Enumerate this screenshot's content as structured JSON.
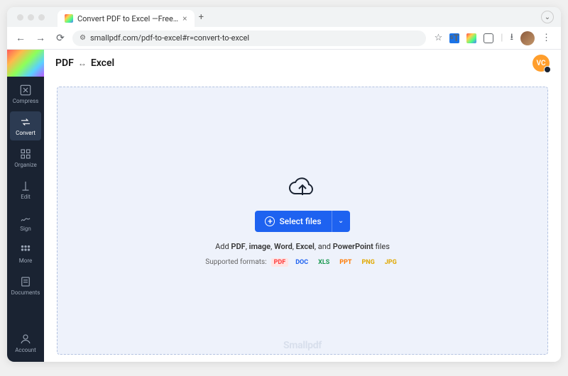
{
  "browser": {
    "tab_title": "Convert PDF to Excel —Free…",
    "url": "smallpdf.com/pdf-to-excel#r=convert-to-excel"
  },
  "sidebar": {
    "items": [
      {
        "label": "Compress"
      },
      {
        "label": "Convert"
      },
      {
        "label": "Organize"
      },
      {
        "label": "Edit"
      },
      {
        "label": "Sign"
      },
      {
        "label": "More"
      },
      {
        "label": "Documents"
      }
    ],
    "account_label": "Account"
  },
  "page": {
    "title_left": "PDF",
    "title_right": "Excel",
    "avatar_initials": "VC"
  },
  "upload": {
    "button_label": "Select files",
    "hint_prefix": "Add ",
    "hint_b1": "PDF",
    "hint_s1": ", ",
    "hint_b2": "image",
    "hint_s2": ", ",
    "hint_b3": "Word",
    "hint_s3": ", ",
    "hint_b4": "Excel",
    "hint_s4": ", and ",
    "hint_b5": "PowerPoint",
    "hint_suffix": " files",
    "supported_label": "Supported formats:",
    "formats": {
      "pdf": "PDF",
      "doc": "DOC",
      "xls": "XLS",
      "ppt": "PPT",
      "png": "PNG",
      "jpg": "JPG"
    },
    "watermark": "Smallpdf"
  }
}
